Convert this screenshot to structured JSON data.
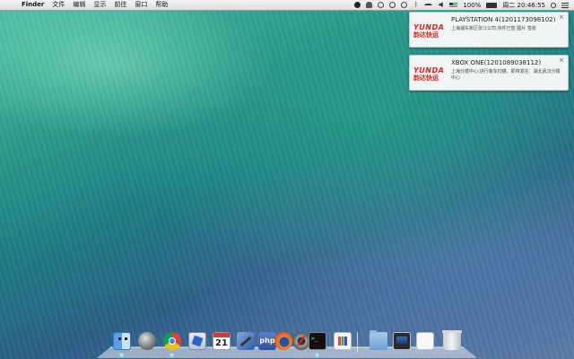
{
  "menubar": {
    "apple_glyph": "",
    "app_name": "Finder",
    "menus": [
      "文件",
      "编辑",
      "显示",
      "前往",
      "窗口",
      "帮助"
    ],
    "battery_percent": "100%",
    "clock": "周二 20:46:55"
  },
  "notifications": [
    {
      "logo_line1": "YUNDA",
      "logo_line2": "韵达快运",
      "title": "PLAYSTATION 4(1201173098102)",
      "body": "上海浦东新区张江公司:快件已签 图片 签收",
      "close": "×"
    },
    {
      "logo_line1": "YUNDA",
      "logo_line2": "韵达快运",
      "title": "XBOX ONE(1201089038112)",
      "body": "上海分拨中心:进行装车扫描，即将发往：湖北武汉分拨中心",
      "close": "×"
    }
  ],
  "dock": {
    "calendar_day": "21",
    "php_label": "php",
    "terminal_prompt": ">_",
    "icons": [
      "finder-icon",
      "launchpad-icon",
      "chrome-icon",
      "mail-icon",
      "calendar-icon",
      "xcode-icon",
      "php-icon",
      "firefox-icon",
      "ichat-icon",
      "terminal-icon",
      "grid-app-icon",
      "folder-icon",
      "screenshot-icon",
      "document-icon",
      "trash-icon"
    ]
  }
}
